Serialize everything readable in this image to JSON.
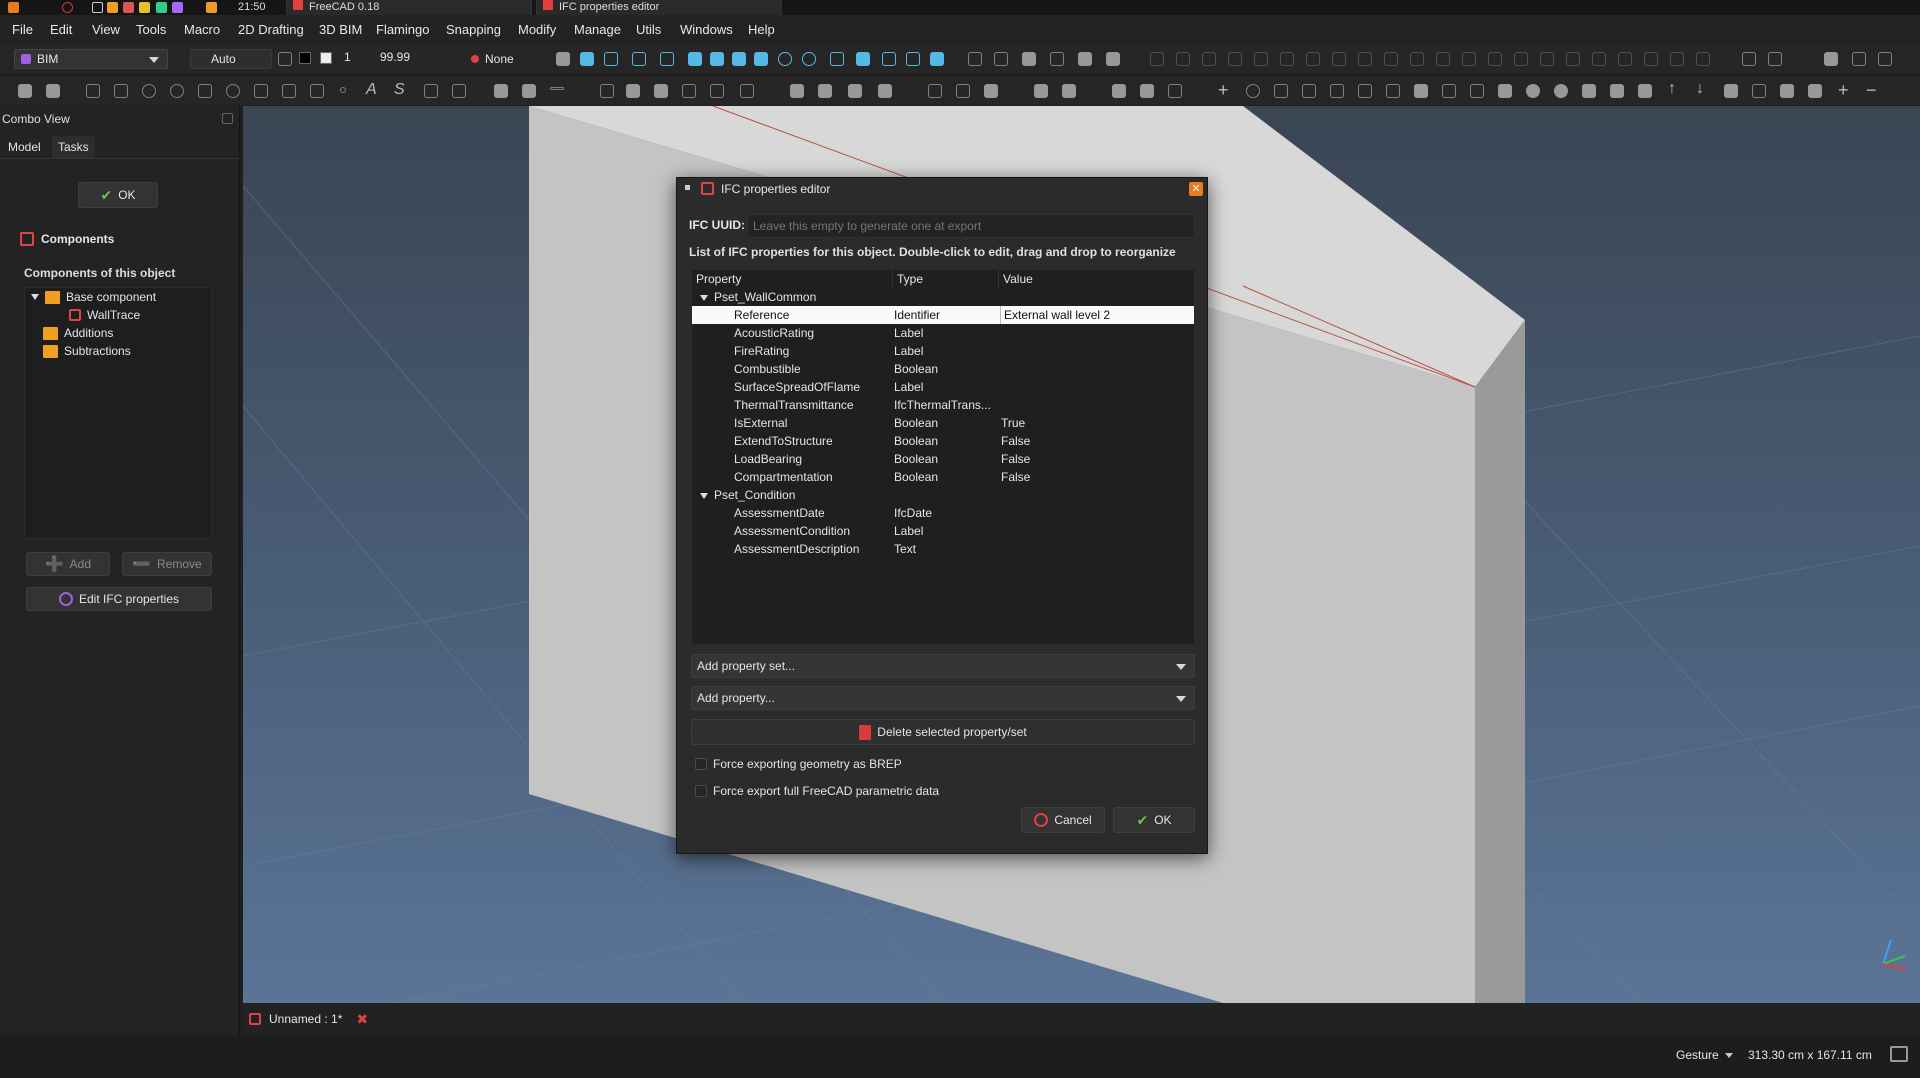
{
  "system_bar": {
    "time": "21:50",
    "task1": "FreeCAD 0.18",
    "task2": "IFC properties editor"
  },
  "menu": [
    "File",
    "Edit",
    "View",
    "Tools",
    "Macro",
    "2D Drafting",
    "3D BIM",
    "Flamingo",
    "Snapping",
    "Modify",
    "Manage",
    "Utils",
    "Windows",
    "Help"
  ],
  "toolbar": {
    "workbench": "BIM",
    "snap_mode": "Auto",
    "line_width": "1",
    "value": "99.99",
    "none_label": "None"
  },
  "combo_view": {
    "title": "Combo View",
    "tabs": [
      "Model",
      "Tasks"
    ],
    "ok_label": "OK",
    "components_title": "Components",
    "components_subtitle": "Components of this object",
    "tree": {
      "base": "Base component",
      "walltrace": "WallTrace",
      "additions": "Additions",
      "subtractions": "Subtractions"
    },
    "add_label": "Add",
    "remove_label": "Remove",
    "edit_ifc_label": "Edit IFC properties"
  },
  "dialog": {
    "title": "IFC properties editor",
    "uuid_label": "IFC UUID:",
    "uuid_placeholder": "Leave this empty to generate one at export",
    "description": "List of IFC properties for this object. Double-click to edit, drag and drop to reorganize",
    "columns": [
      "Property",
      "Type",
      "Value"
    ],
    "sets": [
      {
        "name": "Pset_WallCommon",
        "rows": [
          {
            "p": "Reference",
            "t": "Identifier",
            "v": "External wall level 2"
          },
          {
            "p": "AcousticRating",
            "t": "Label",
            "v": ""
          },
          {
            "p": "FireRating",
            "t": "Label",
            "v": ""
          },
          {
            "p": "Combustible",
            "t": "Boolean",
            "v": ""
          },
          {
            "p": "SurfaceSpreadOfFlame",
            "t": "Label",
            "v": ""
          },
          {
            "p": "ThermalTransmittance",
            "t": "IfcThermalTrans...",
            "v": ""
          },
          {
            "p": "IsExternal",
            "t": "Boolean",
            "v": "True"
          },
          {
            "p": "ExtendToStructure",
            "t": "Boolean",
            "v": "False"
          },
          {
            "p": "LoadBearing",
            "t": "Boolean",
            "v": "False"
          },
          {
            "p": "Compartmentation",
            "t": "Boolean",
            "v": "False"
          }
        ]
      },
      {
        "name": "Pset_Condition",
        "rows": [
          {
            "p": "AssessmentDate",
            "t": "IfcDate",
            "v": ""
          },
          {
            "p": "AssessmentCondition",
            "t": "Label",
            "v": ""
          },
          {
            "p": "AssessmentDescription",
            "t": "Text",
            "v": ""
          }
        ]
      }
    ],
    "add_property_set": "Add property set...",
    "add_property": "Add property...",
    "delete_label": "Delete selected property/set",
    "chk_brep": "Force exporting geometry as BREP",
    "chk_param": "Force export full FreeCAD parametric data",
    "cancel_label": "Cancel",
    "ok_label": "OK"
  },
  "document_tab": "Unnamed : 1*",
  "status": {
    "nav": "Gesture",
    "dims": "313.30 cm x 167.11 cm"
  },
  "colors": {
    "accent_orange": "#e87b1c",
    "selection_bg": "#fafafa",
    "icon_blue": "#55b9e6"
  }
}
